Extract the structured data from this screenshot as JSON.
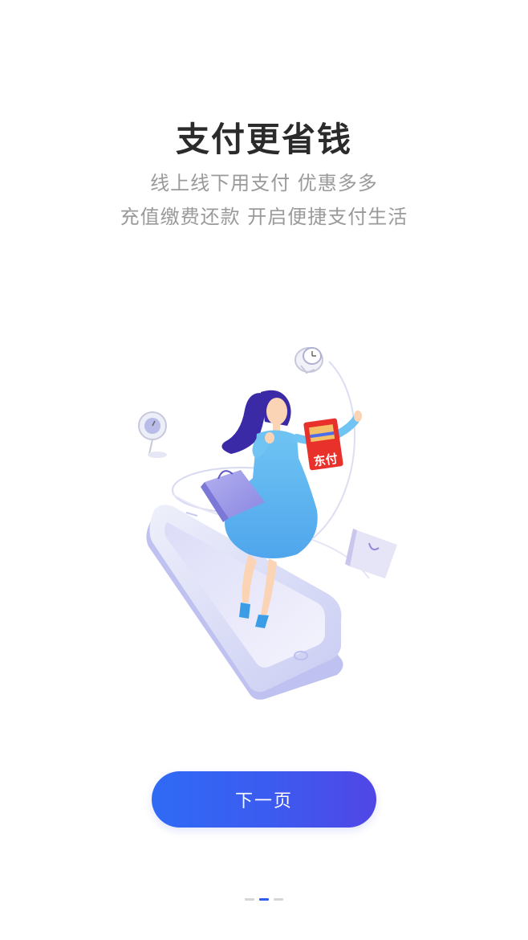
{
  "onboarding": {
    "title": "支付更省钱",
    "subtitle_line1": "线上线下用支付 优惠多多",
    "subtitle_line2": "充值缴费还款 开启便捷支付生活",
    "card_label": "东付",
    "next_button_label": "下一页",
    "page_indicator": {
      "total": 3,
      "active_index": 1
    }
  },
  "colors": {
    "accent": "#2f6af5",
    "accent_end": "#5046e6",
    "title": "#2b2b2b",
    "subtitle": "#9a9a9a",
    "card_red": "#e8312a"
  },
  "illustration": {
    "icons": [
      "clock-icon",
      "location-pin-icon",
      "shopping-bag-icon",
      "payment-card-icon",
      "smartphone-icon"
    ]
  }
}
